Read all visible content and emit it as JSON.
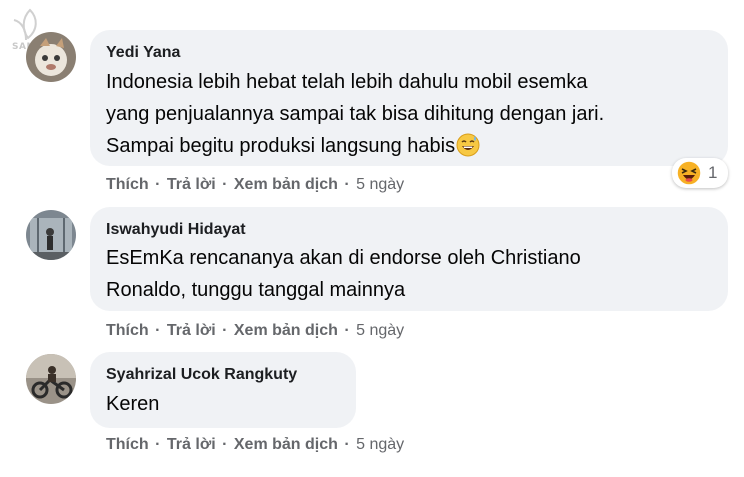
{
  "watermark": {
    "text": "SANH CO"
  },
  "comments": [
    {
      "name": "Yedi Yana",
      "lines": [
        "Indonesia lebih hebat telah lebih dahulu mobil esemka",
        "yang penjualannya sampai tak bisa dihitung dengan jari.",
        "Sampai begitu produksi langsung habis"
      ],
      "emoji": "grinning-sweat-emoji",
      "actions": {
        "like": "Thích",
        "reply": "Trả lời",
        "translate": "Xem bản dịch",
        "time": "5 ngày"
      },
      "reaction": {
        "icon": "haha-reaction-icon",
        "count": "1"
      }
    },
    {
      "name": "Iswahyudi Hidayat",
      "lines": [
        "EsEmKa rencananya akan di endorse oleh Christiano",
        "Ronaldo, tunggu tanggal mainnya"
      ],
      "actions": {
        "like": "Thích",
        "reply": "Trả lời",
        "translate": "Xem bản dịch",
        "time": "5 ngày"
      }
    },
    {
      "name": "Syahrizal Ucok Rangkuty",
      "lines": [
        "Keren"
      ],
      "actions": {
        "like": "Thích",
        "reply": "Trả lời",
        "translate": "Xem bản dịch",
        "time": "5 ngày"
      }
    }
  ],
  "separator": "·",
  "colors": {
    "bubble": "#f0f2f5",
    "meta": "#65676b",
    "text": "#050505"
  }
}
